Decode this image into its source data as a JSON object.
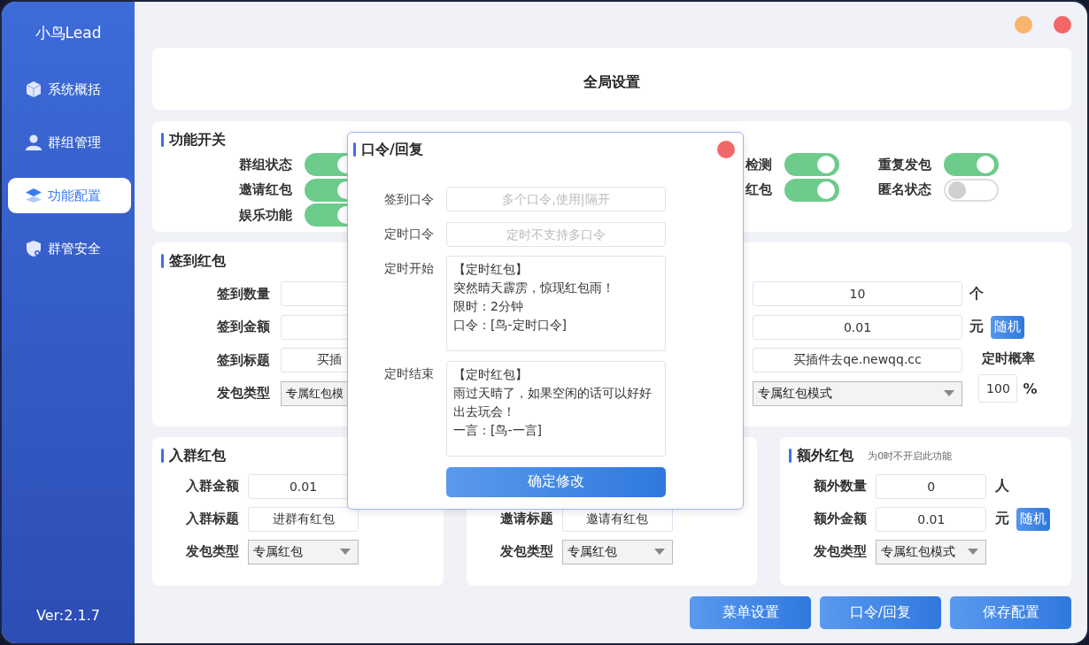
{
  "sidebar": {
    "logo": "小鸟Lead",
    "items": [
      {
        "label": "系统概括",
        "selected": false
      },
      {
        "label": "群组管理",
        "selected": false
      },
      {
        "label": "功能配置",
        "selected": true
      },
      {
        "label": "群管安全",
        "selected": false
      }
    ],
    "version": "Ver:2.1.7"
  },
  "header": {
    "title": "全局设置"
  },
  "switches": {
    "title": "功能开关",
    "columns": [
      {
        "items": [
          {
            "label": "群组状态",
            "on": true
          },
          {
            "label": "邀请红包",
            "on": true
          },
          {
            "label": "娱乐功能",
            "on": true
          }
        ]
      },
      {
        "items": [
          {
            "label": "检测",
            "on": true
          },
          {
            "label": "红包",
            "on": true
          }
        ]
      },
      {
        "items": [
          {
            "label": "重复发包",
            "on": true
          },
          {
            "label": "匿名状态",
            "on": false
          }
        ]
      }
    ]
  },
  "sign_in": {
    "title": "签到红包",
    "rows": [
      {
        "label": "签到数量",
        "left": {
          "kind": "input"
        },
        "right": {
          "kind": "input",
          "value": "10",
          "unit": "个"
        }
      },
      {
        "label": "签到金额",
        "left": {
          "kind": "input"
        },
        "right": {
          "kind": "input",
          "value": "0.01",
          "unit": "元",
          "button": "随机"
        }
      },
      {
        "label": "签到标题",
        "left": {
          "kind": "input",
          "value": "买插"
        },
        "right": {
          "kind": "input",
          "value": "买插件去qe.newqq.cc"
        }
      },
      {
        "label": "发包类型",
        "left": {
          "kind": "select",
          "value": "专属红包模"
        },
        "right": {
          "kind": "select",
          "value": "专属红包模式"
        }
      }
    ],
    "probability": {
      "label": "定时概率",
      "value": "100",
      "unit": "%"
    }
  },
  "cards": [
    {
      "title": "入群红包",
      "rows": [
        {
          "label": "入群金额",
          "kind": "input",
          "value": "0.01"
        },
        {
          "label": "入群标题",
          "kind": "input",
          "value": "进群有红包"
        },
        {
          "label": "发包类型",
          "kind": "select",
          "value": "专属红包"
        }
      ]
    },
    {
      "rows": [
        {
          "label": "邀请标题",
          "kind": "input",
          "value": "邀请有红包"
        },
        {
          "label": "发包类型",
          "kind": "select",
          "value": "专属红包"
        }
      ]
    },
    {
      "title": "额外红包",
      "note": "为0时不开启此功能",
      "rows": [
        {
          "label": "额外数量",
          "kind": "input",
          "value": "0",
          "unit": "人"
        },
        {
          "label": "额外金额",
          "kind": "input",
          "value": "0.01",
          "unit": "元",
          "button": "随机"
        },
        {
          "label": "发包类型",
          "kind": "select",
          "value": "专属红包模式"
        }
      ]
    }
  ],
  "actions": [
    {
      "label": "菜单设置"
    },
    {
      "label": "口令/回复"
    },
    {
      "label": "保存配置"
    }
  ],
  "dialog": {
    "title": "口令/回复",
    "fields": [
      {
        "label": "签到口令",
        "kind": "input",
        "placeholder": "多个口令,使用|隔开"
      },
      {
        "label": "定时口令",
        "kind": "input",
        "placeholder": "定时不支持多口令"
      },
      {
        "label": "定时开始",
        "kind": "textarea",
        "lines": [
          "【定时红包】",
          "突然晴天霹雳，惊现红包雨！",
          "限时：2分钟",
          "口令：[鸟-定时口令]"
        ]
      },
      {
        "label": "定时结束",
        "kind": "textarea",
        "lines": [
          "【定时红包】",
          "雨过天晴了，如果空闲的话可以好好出去玩会！",
          "一言：[鸟-一言]"
        ]
      }
    ],
    "submit": "确定修改"
  }
}
